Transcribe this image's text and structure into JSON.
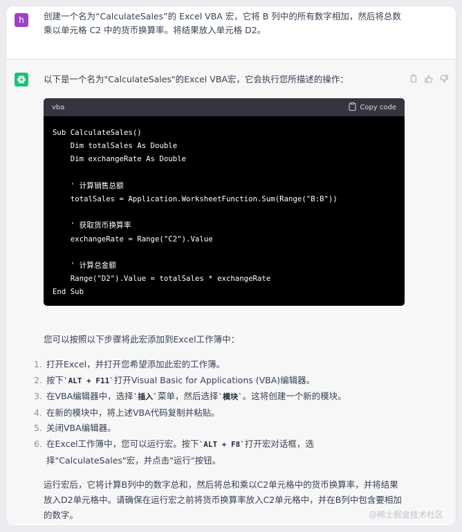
{
  "user": {
    "avatar_letter": "h",
    "message": "创建一个名为“CalculateSales”的 Excel VBA 宏，它将 B 列中的所有数字相加，然后将总数乘以单元格 C2 中的货币换算率。将结果放入单元格 D2。"
  },
  "assistant": {
    "intro": "以下是一个名为\"CalculateSales\"的Excel VBA宏，它会执行您所描述的操作：",
    "code": {
      "language": "vba",
      "copy_label": "Copy code",
      "lines": [
        "Sub CalculateSales()",
        "    Dim totalSales As Double",
        "    Dim exchangeRate As Double",
        "",
        "    ' 计算销售总额",
        "    totalSales = Application.WorksheetFunction.Sum(Range(\"B:B\"))",
        "",
        "    ' 获取货币换算率",
        "    exchangeRate = Range(\"C2\").Value",
        "",
        "    ' 计算总金额",
        "    Range(\"D2\").Value = totalSales * exchangeRate",
        "End Sub"
      ]
    },
    "steps_intro": "您可以按照以下步骤将此宏添加到Excel工作簿中：",
    "steps": [
      {
        "num": "1.",
        "parts": [
          {
            "t": "打开Excel，并打开您希望添加此宏的工作簿。"
          }
        ]
      },
      {
        "num": "2.",
        "parts": [
          {
            "t": "按下"
          },
          {
            "k": "`ALT + F11`"
          },
          {
            "t": "打开Visual Basic for Applications (VBA)编辑器。"
          }
        ]
      },
      {
        "num": "3.",
        "parts": [
          {
            "t": "在VBA编辑器中，选择"
          },
          {
            "k": "`插入`"
          },
          {
            "t": "菜单，然后选择"
          },
          {
            "k": "`模块`"
          },
          {
            "t": "。这将创建一个新的模块。"
          }
        ]
      },
      {
        "num": "4.",
        "parts": [
          {
            "t": "在新的模块中，将上述VBA代码复制并粘贴。"
          }
        ]
      },
      {
        "num": "5.",
        "parts": [
          {
            "t": "关闭VBA编辑器。"
          }
        ]
      },
      {
        "num": "6.",
        "parts": [
          {
            "t": "在Excel工作簿中，您可以运行宏。按下"
          },
          {
            "k": "`ALT + F8`"
          },
          {
            "t": "打开宏对话框，选择\"CalculateSales\"宏，并点击\"运行\"按钮。"
          }
        ]
      }
    ],
    "conclusion": "运行宏后，它将计算B列中的数字总和，然后将总和乘以C2单元格中的货币换算率，并将结果放入D2单元格中。请确保在运行宏之前将货币换算率放入C2单元格中，并在B列中包含要相加的数字。"
  },
  "watermark": "@稀土掘金技术社区",
  "colors": {
    "user_avatar": "#a141c4",
    "bot_avatar": "#19c37d",
    "code_bg": "#000000",
    "code_header": "#343541"
  }
}
